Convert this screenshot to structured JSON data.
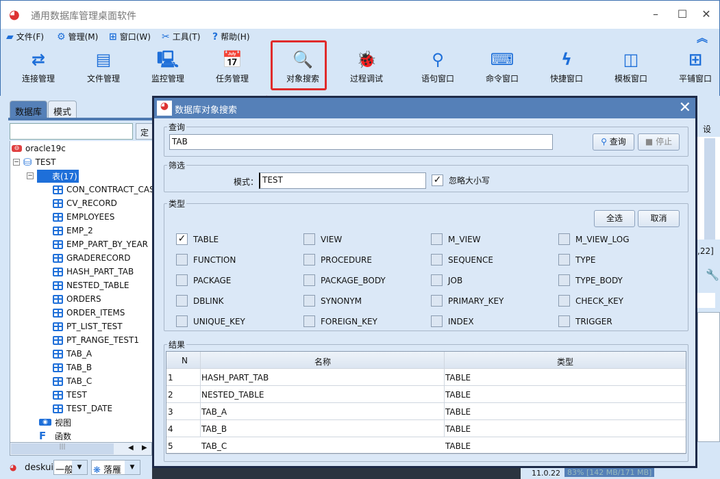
{
  "app": {
    "title": "通用数据库管理桌面软件",
    "window_controls": [
      "minimize",
      "maximize",
      "close"
    ]
  },
  "menu": [
    {
      "label": "文件(F)",
      "icon": "folder-icon"
    },
    {
      "label": "管理(M)",
      "icon": "gear-icon"
    },
    {
      "label": "窗口(W)",
      "icon": "windows-icon"
    },
    {
      "label": "工具(T)",
      "icon": "tools-icon"
    },
    {
      "label": "帮助(H)",
      "icon": "help-icon"
    }
  ],
  "toolbar": [
    {
      "label": "连接管理",
      "icon": "⇄"
    },
    {
      "label": "文件管理",
      "icon": "▤"
    },
    {
      "label": "监控管理",
      "icon": "🖳"
    },
    {
      "label": "任务管理",
      "icon": "📅"
    },
    {
      "label": "对象搜索",
      "icon": "🔍"
    },
    {
      "label": "过程调试",
      "icon": "🐞"
    },
    {
      "label": "语句窗口",
      "icon": "⚲"
    },
    {
      "label": "命令窗口",
      "icon": "⌨"
    },
    {
      "label": "快捷窗口",
      "icon": "ϟ"
    },
    {
      "label": "模板窗口",
      "icon": "◫"
    },
    {
      "label": "平铺窗口",
      "icon": "⊞"
    }
  ],
  "left": {
    "tabs": [
      "数据库",
      "模式"
    ],
    "filter_value": "",
    "locate_button": "定",
    "tree": {
      "connection": "oracle19c",
      "database": "TEST",
      "tables_node": "表(17)",
      "tables": [
        "CON_CONTRACT_CAS",
        "CV_RECORD",
        "EMPLOYEES",
        "EMP_2",
        "EMP_PART_BY_YEAR",
        "GRADERECORD",
        "HASH_PART_TAB",
        "NESTED_TABLE",
        "ORDERS",
        "ORDER_ITEMS",
        "PT_LIST_TEST",
        "PT_RANGE_TEST1",
        "TAB_A",
        "TAB_B",
        "TAB_C",
        "TEST",
        "TEST_DATE"
      ],
      "views_node": "视图",
      "functions_node": "函数"
    }
  },
  "status": {
    "user": "deskui",
    "mode": "一般",
    "theme": "落雁",
    "version": "11.0.22",
    "memory": "83% [142 MB/171 MB]"
  },
  "right_peek": {
    "settings": "设",
    "coords": ",22]"
  },
  "dialog": {
    "title": "数据库对象搜索",
    "query": {
      "legend": "查询",
      "value": "TAB",
      "search_button": "查询",
      "stop_button": "停止"
    },
    "filter": {
      "legend": "筛选",
      "schema_label": "模式：",
      "schema_value": "TEST",
      "ignore_case_label": "忽略大小写",
      "ignore_case": true
    },
    "types": {
      "legend": "类型",
      "select_all": "全选",
      "cancel": "取消",
      "items": [
        {
          "label": "TABLE",
          "checked": true
        },
        {
          "label": "VIEW",
          "checked": false
        },
        {
          "label": "M_VIEW",
          "checked": false
        },
        {
          "label": "M_VIEW_LOG",
          "checked": false
        },
        {
          "label": "FUNCTION",
          "checked": false
        },
        {
          "label": "PROCEDURE",
          "checked": false
        },
        {
          "label": "SEQUENCE",
          "checked": false
        },
        {
          "label": "TYPE",
          "checked": false
        },
        {
          "label": "PACKAGE",
          "checked": false
        },
        {
          "label": "PACKAGE_BODY",
          "checked": false
        },
        {
          "label": "JOB",
          "checked": false
        },
        {
          "label": "TYPE_BODY",
          "checked": false
        },
        {
          "label": "DBLINK",
          "checked": false
        },
        {
          "label": "SYNONYM",
          "checked": false
        },
        {
          "label": "PRIMARY_KEY",
          "checked": false
        },
        {
          "label": "CHECK_KEY",
          "checked": false
        },
        {
          "label": "UNIQUE_KEY",
          "checked": false
        },
        {
          "label": "FOREIGN_KEY",
          "checked": false
        },
        {
          "label": "INDEX",
          "checked": false
        },
        {
          "label": "TRIGGER",
          "checked": false
        }
      ]
    },
    "results": {
      "legend": "结果",
      "columns": [
        "N",
        "名称",
        "类型"
      ],
      "rows": [
        [
          "1",
          "HASH_PART_TAB",
          "TABLE"
        ],
        [
          "2",
          "NESTED_TABLE",
          "TABLE"
        ],
        [
          "3",
          "TAB_A",
          "TABLE"
        ],
        [
          "4",
          "TAB_B",
          "TABLE"
        ],
        [
          "5",
          "TAB_C",
          "TABLE"
        ]
      ]
    }
  },
  "colors": {
    "accent": "#1e6fd9",
    "highlight": "#e02b2b",
    "panel": "#d6e6f7",
    "dialog_title": "#5580b8"
  }
}
